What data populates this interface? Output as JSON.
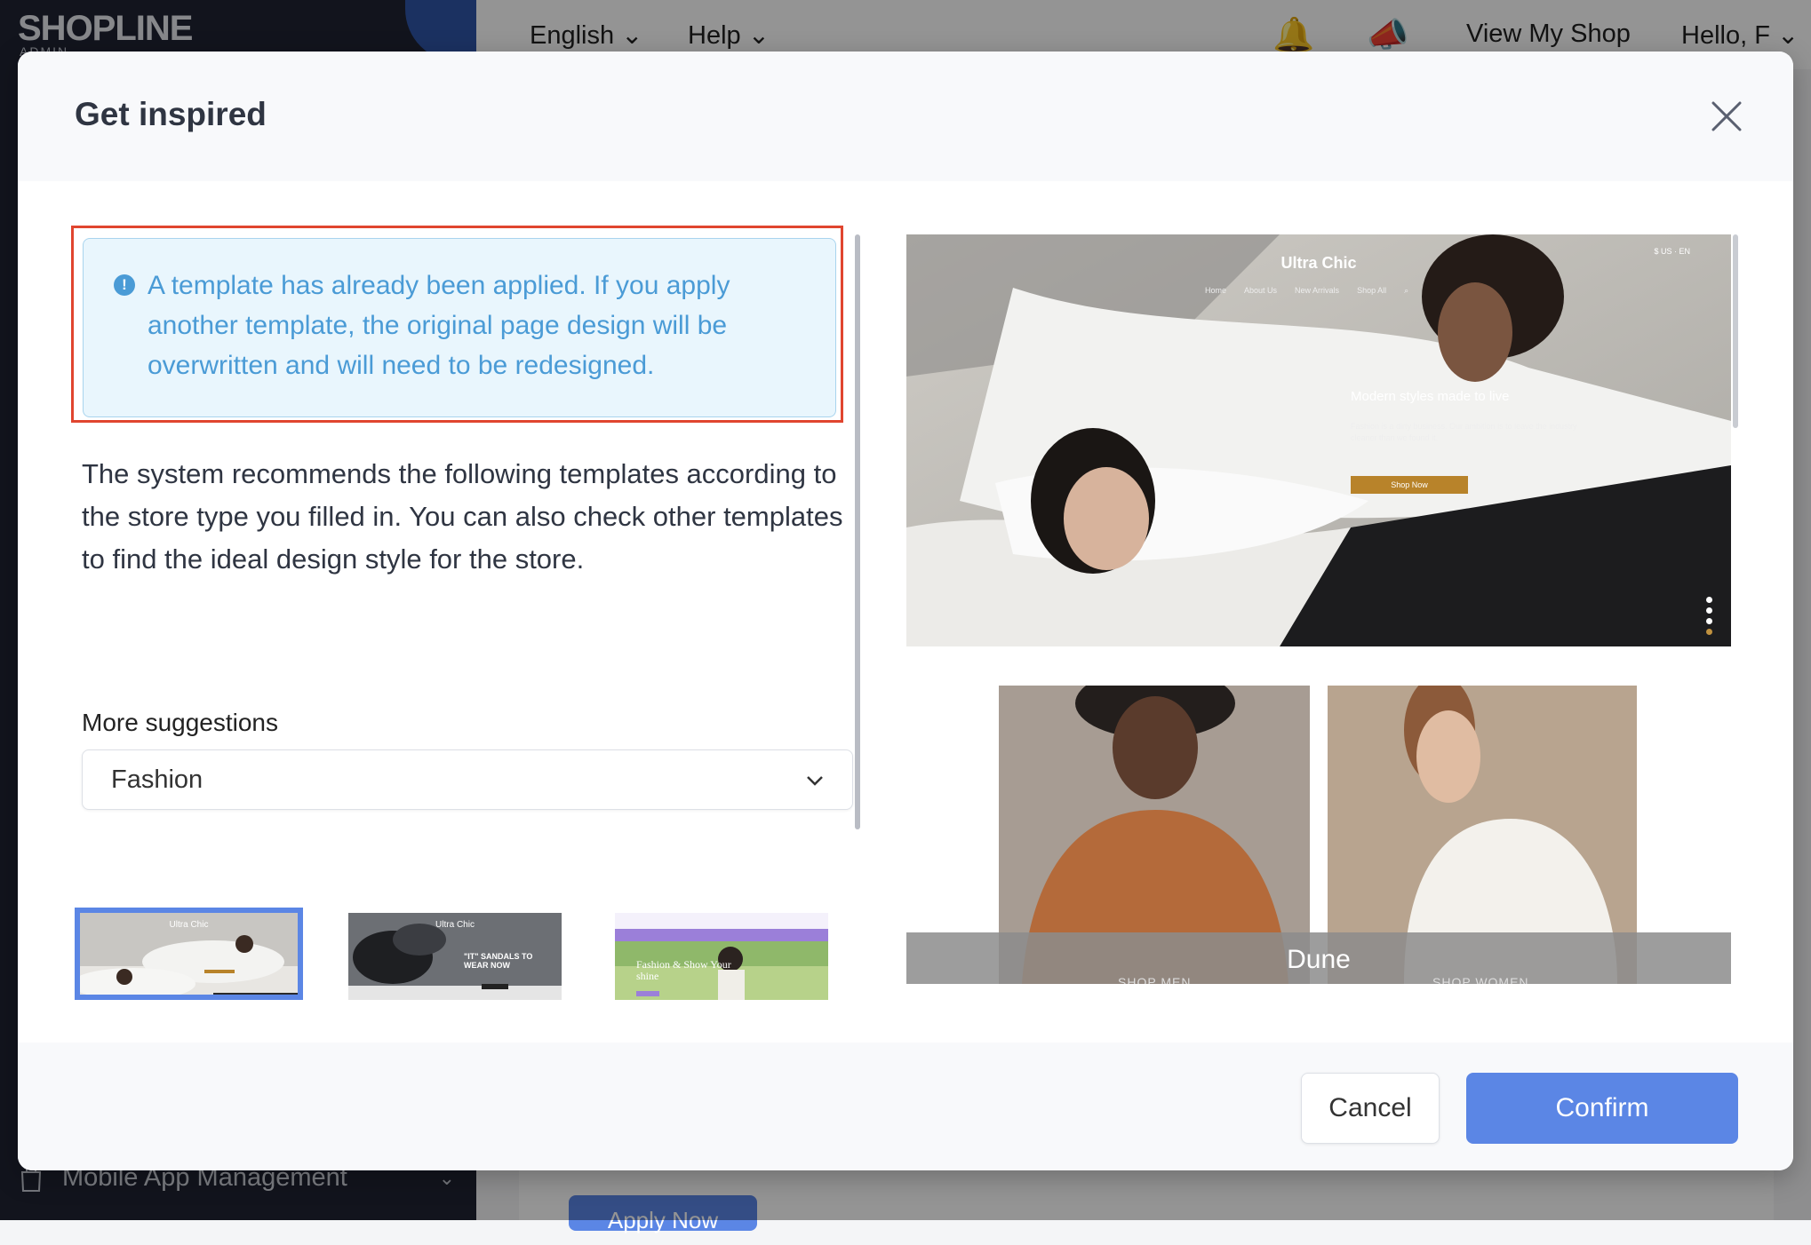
{
  "background": {
    "logo": "SHOPLINE",
    "logo_sub": "ADMIN",
    "topbar": {
      "language": "English",
      "help": "Help",
      "view_shop": "View My Shop",
      "greeting": "Hello, F"
    },
    "sidebar_bottom_item": "Mobile App Management",
    "apply_button": "Apply Now"
  },
  "modal": {
    "title": "Get inspired",
    "notice": "A template has already been applied. If you apply another template, the original page design will be overwritten and will need to be redesigned.",
    "recommend_text": "The system recommends the following templates according to the store type you filled in. You can also check other templates to find the ideal design style for the store.",
    "more_suggestions_label": "More suggestions",
    "category_selected": "Fashion",
    "thumbnails": [
      {
        "title": "Ultra Chic",
        "selected": true
      },
      {
        "title": "Ultra Chic",
        "headline": "\"IT\" SANDALS TO WEAR NOW",
        "selected": false
      },
      {
        "title": "",
        "headline": "Fashion & Show Your shine",
        "selected": false
      }
    ],
    "preview": {
      "site_title": "Ultra Chic",
      "nav": [
        "Home",
        "About Us",
        "New Arrivals",
        "Shop All"
      ],
      "topright": "$ US  ·  EN",
      "headline": "Modern styles made to live",
      "body": "Fashion is a dirty business. Our ambition is to leave the industry cleaner than we found it.",
      "button": "Shop Now"
    },
    "second_preview": {
      "name": "Dune",
      "shop_men": "SHOP MEN",
      "shop_women": "SHOP WOMEN"
    },
    "buttons": {
      "cancel": "Cancel",
      "confirm": "Confirm"
    },
    "colors": {
      "primary": "#5b86e5",
      "notice_text": "#4a9bd6",
      "notice_bg": "#e9f6fd",
      "highlight_outline": "#e0452f"
    }
  }
}
